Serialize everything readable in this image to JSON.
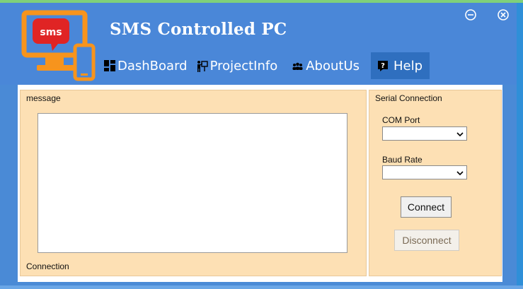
{
  "header": {
    "title": "SMS Controlled PC",
    "logo_text": "sms"
  },
  "window_controls": {
    "minimize_icon": "minus-circle-icon",
    "close_icon": "x-circle-icon"
  },
  "nav": {
    "items": [
      {
        "label": "DashBoard",
        "icon": "dashboard-icon"
      },
      {
        "label": "ProjectInfo",
        "icon": "presentation-icon"
      },
      {
        "label": "AboutUs",
        "icon": "group-icon"
      },
      {
        "label": "Help",
        "icon": "help-icon"
      }
    ],
    "active": "Help"
  },
  "message_panel": {
    "label": "message",
    "footer_label": "Connection",
    "message_text": ""
  },
  "serial_panel": {
    "label": "Serial Connection",
    "com_port_label": "COM Port",
    "com_port_value": "",
    "baud_rate_label": "Baud Rate",
    "baud_rate_value": "",
    "connect_label": "Connect",
    "disconnect_label": "Disconnect"
  },
  "colors": {
    "header": "#4a87d8",
    "panel": "#fde0b4",
    "logo_orange": "#f7941d",
    "logo_red": "#e02424"
  }
}
